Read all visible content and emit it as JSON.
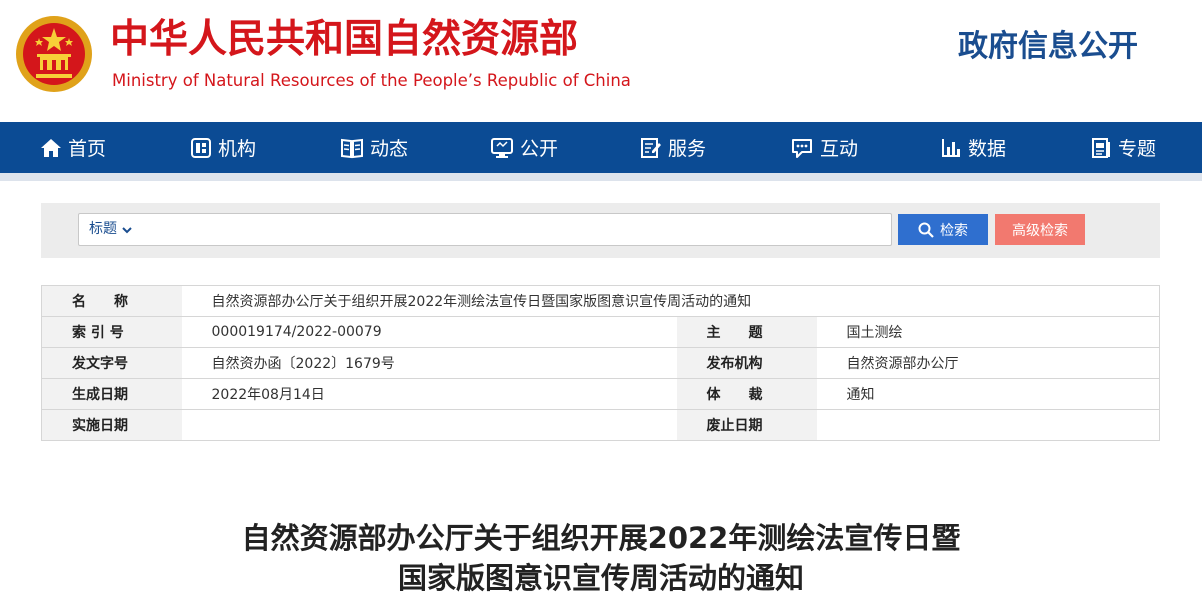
{
  "header": {
    "site_name_cn": "中华人民共和国自然资源部",
    "site_name_en": "Ministry of Natural Resources of the People’s Republic of China",
    "section_title": "政府信息公开",
    "emblem_icon": "national-emblem-icon"
  },
  "nav": {
    "items": [
      {
        "label": "首页",
        "icon": "home-icon"
      },
      {
        "label": "机构",
        "icon": "org-icon"
      },
      {
        "label": "动态",
        "icon": "book-icon"
      },
      {
        "label": "公开",
        "icon": "monitor-icon"
      },
      {
        "label": "服务",
        "icon": "edit-icon"
      },
      {
        "label": "互动",
        "icon": "chat-icon"
      },
      {
        "label": "数据",
        "icon": "bar-chart-icon"
      },
      {
        "label": "专题",
        "icon": "document-icon"
      }
    ]
  },
  "search": {
    "type_label": "标题",
    "input_value": "",
    "search_button": "检索",
    "advanced_button": "高级检索"
  },
  "meta": {
    "name_label": "名　　称",
    "name_value": "自然资源部办公厅关于组织开展2022年测绘法宣传日暨国家版图意识宣传周活动的通知",
    "index_label": "索 引 号",
    "index_value": "000019174/2022-00079",
    "subject_label": "主　　题",
    "subject_value": "国土测绘",
    "doc_no_label": "发文字号",
    "doc_no_value": "自然资办函〔2022〕1679号",
    "issuer_label": "发布机构",
    "issuer_value": "自然资源部办公厅",
    "date_label": "生成日期",
    "date_value": "2022年08月14日",
    "genre_label": "体　　裁",
    "genre_value": "通知",
    "effective_label": "实施日期",
    "effective_value": "",
    "expire_label": "废止日期",
    "expire_value": ""
  },
  "article": {
    "title_line1": "自然资源部办公厅关于组织开展2022年测绘法宣传日暨",
    "title_line2": "国家版图意识宣传周活动的通知"
  },
  "colors": {
    "brand_red": "#d4161b",
    "nav_blue": "#0b4b94",
    "search_blue": "#2f6fcf",
    "advanced_red": "#f2796f"
  }
}
